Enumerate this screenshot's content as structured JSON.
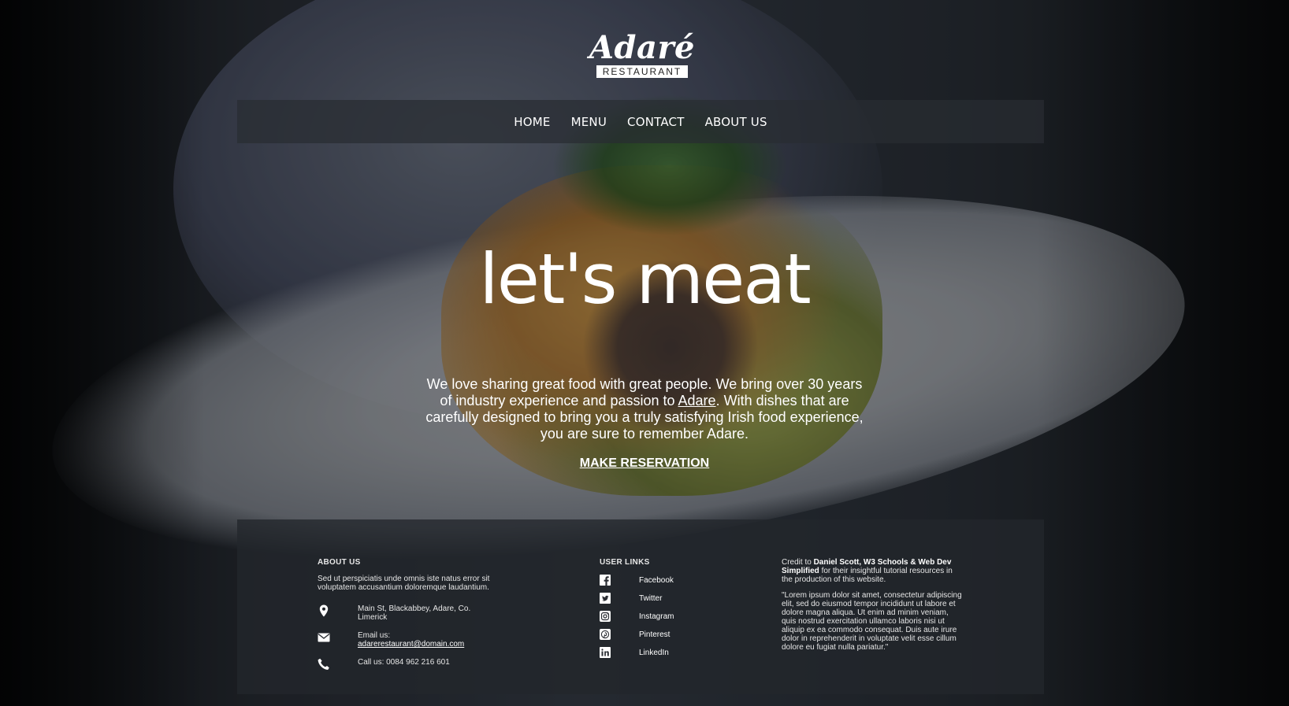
{
  "logo": {
    "name": "Adaré",
    "subtitle": "RESTAURANT"
  },
  "nav": {
    "items": [
      {
        "label": "HOME"
      },
      {
        "label": "MENU"
      },
      {
        "label": "CONTACT"
      },
      {
        "label": "ABOUT US"
      }
    ]
  },
  "hero": {
    "title": "let's meat",
    "text_before_link": "We love sharing great food with great people. We bring over 30 years of industry experience and passion to ",
    "link_text": "Adare",
    "text_after_link": ". With dishes that are carefully designed to bring you a truly satisfying Irish food experience, you are sure to remember Adare.",
    "cta_label": "MAKE RESERVATION"
  },
  "footer": {
    "about": {
      "title": "ABOUT US",
      "text": "Sed ut perspiciatis unde omnis iste natus error sit voluptatem accusantium doloremque laudantium.",
      "address": "Main St, Blackabbey, Adare, Co. Limerick",
      "email_label": "Email us:",
      "email": "adarerestaurant@domain.com",
      "phone": "Call us: 0084 962 216 601"
    },
    "links": {
      "title": "USER LINKS",
      "items": [
        {
          "label": "Facebook",
          "icon": "facebook-icon"
        },
        {
          "label": "Twitter",
          "icon": "twitter-icon"
        },
        {
          "label": "Instagram",
          "icon": "instagram-icon"
        },
        {
          "label": "Pinterest",
          "icon": "pinterest-icon"
        },
        {
          "label": "LinkedIn",
          "icon": "linkedin-icon"
        }
      ]
    },
    "credit": {
      "prefix": "Credit to ",
      "names": "Daniel Scott, W3 Schools & Web Dev Simplified",
      "suffix": " for their insightful tutorial resources in the production of this website.",
      "quote": "\"Lorem ipsum dolor sit amet, consectetur adipiscing elit, sed do eiusmod tempor incididunt ut labore et dolore magna aliqua. Ut enim ad minim veniam, quis nostrud exercitation ullamco laboris nisi ut aliquip ex ea commodo consequat. Duis aute irure dolor in reprehenderit in voluptate velit esse cillum dolore eu fugiat nulla pariatur.\""
    }
  }
}
